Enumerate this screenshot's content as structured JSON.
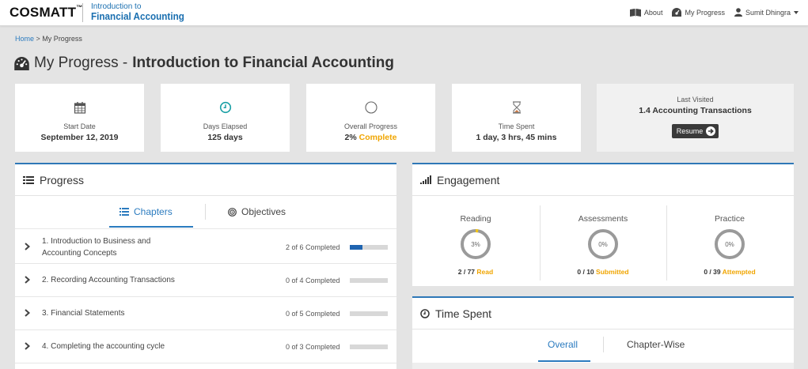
{
  "header": {
    "brand": "COSMATT",
    "brand_tm": "™",
    "course_line1": "Introduction to",
    "course_line2": "Financial Accounting",
    "nav": [
      {
        "label": "About",
        "icon": "book-icon"
      },
      {
        "label": "My Progress",
        "icon": "dashboard-icon"
      },
      {
        "label": "Sumit Dhingra",
        "icon": "user-icon"
      }
    ]
  },
  "breadcrumb": {
    "home": "Home",
    "sep": ">",
    "current": "My Progress"
  },
  "title": {
    "prefix": "My Progress -",
    "course": "Introduction to Financial Accounting"
  },
  "stats": {
    "start_date": {
      "label": "Start Date",
      "value": "September 12, 2019"
    },
    "days_elapsed": {
      "label": "Days Elapsed",
      "value": "125 days"
    },
    "overall_progress": {
      "label": "Overall Progress",
      "value": "2%",
      "suffix": "Complete"
    },
    "time_spent": {
      "label": "Time Spent",
      "value": "1 day, 3 hrs, 45 mins"
    },
    "last_visited": {
      "label": "Last Visited",
      "value": "1.4 Accounting Transactions",
      "button": "Resume"
    }
  },
  "progress": {
    "title": "Progress",
    "tabs": [
      {
        "label": "Chapters"
      },
      {
        "label": "Objectives"
      }
    ],
    "chapters": [
      {
        "title": "1. Introduction to Business and Accounting Concepts",
        "done": 2,
        "total": 6,
        "status": "2 of 6 Completed"
      },
      {
        "title": "2. Recording Accounting Transactions",
        "done": 0,
        "total": 4,
        "status": "0 of 4 Completed"
      },
      {
        "title": "3. Financial Statements",
        "done": 0,
        "total": 5,
        "status": "0 of 5 Completed"
      },
      {
        "title": "4. Completing the accounting cycle",
        "done": 0,
        "total": 3,
        "status": "0 of 3 Completed"
      }
    ]
  },
  "engagement": {
    "title": "Engagement",
    "items": [
      {
        "name": "Reading",
        "percent": 3,
        "percent_label": "3%",
        "stat": "2 / 77",
        "suffix": "Read"
      },
      {
        "name": "Assessments",
        "percent": 0,
        "percent_label": "0%",
        "stat": "0 / 10",
        "suffix": "Submitted"
      },
      {
        "name": "Practice",
        "percent": 0,
        "percent_label": "0%",
        "stat": "0 / 39",
        "suffix": "Attempted"
      }
    ]
  },
  "time_spent": {
    "title": "Time Spent",
    "tabs": [
      {
        "label": "Overall"
      },
      {
        "label": "Chapter-Wise"
      }
    ]
  },
  "colors": {
    "accent": "#2b7bbf",
    "highlight": "#f0a500",
    "bar_fill": "#1f64b0",
    "ring_track": "#9a9a9a",
    "ring_fill": "#f0c419"
  }
}
